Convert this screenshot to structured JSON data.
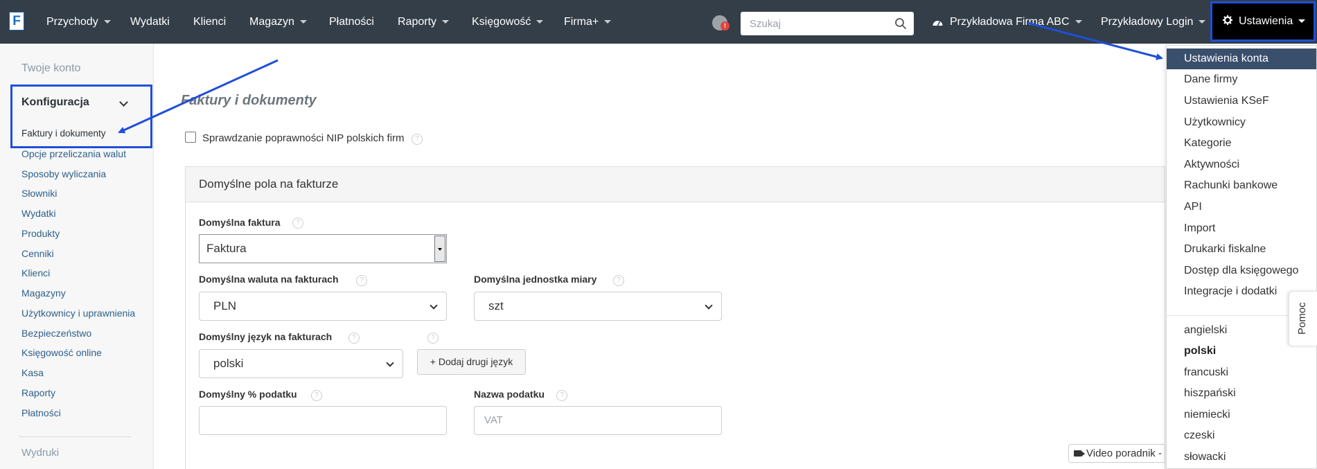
{
  "logo": {
    "letter": "F"
  },
  "nav": {
    "items": [
      {
        "label": "Przychody",
        "dropdown": true
      },
      {
        "label": "Wydatki",
        "dropdown": false
      },
      {
        "label": "Klienci",
        "dropdown": false
      },
      {
        "label": "Magazyn",
        "dropdown": true
      },
      {
        "label": "Płatności",
        "dropdown": false
      },
      {
        "label": "Raporty",
        "dropdown": true
      },
      {
        "label": "Księgowość",
        "dropdown": true
      },
      {
        "label": "Firma+",
        "dropdown": true
      }
    ],
    "search_placeholder": "Szukaj",
    "company": "Przykładowa Firma ABC",
    "login": "Przykładowy Login",
    "settings": "Ustawienia",
    "notification_badge": "!"
  },
  "sidebar": {
    "account": "Twoje konto",
    "section": "Konfiguracja",
    "items": [
      "Faktury i dokumenty",
      "Opcje przeliczania walut",
      "Sposoby wyliczania",
      "Słowniki",
      "Wydatki",
      "Produkty",
      "Cenniki",
      "Klienci",
      "Magazyny",
      "Użytkownicy i uprawnienia",
      "Bezpieczeństwo",
      "Księgowość online",
      "Kasa",
      "Raporty",
      "Płatności"
    ],
    "prints": "Wydruki"
  },
  "main": {
    "title": "Faktury i dokumenty",
    "nip_check_label": "Sprawdzanie poprawności NIP polskich firm",
    "nip_check_checked": false,
    "panel_title": "Domyślne pola na fakturze",
    "fields": {
      "invoice_label": "Domyślna faktura",
      "invoice_value": "Faktura",
      "currency_label": "Domyślna waluta na fakturach",
      "currency_value": "PLN",
      "unit_label": "Domyślna jednostka miary",
      "unit_value": "szt",
      "language_label": "Domyślny język na fakturach",
      "language_value": "polski",
      "add_language_button": "+ Dodaj drugi język",
      "tax_label": "Domyślny % podatku",
      "tax_value": "",
      "tax_name_label": "Nazwa podatku",
      "tax_name_placeholder": "VAT"
    },
    "video_button": "Video poradnik - I"
  },
  "settings_menu": {
    "items": [
      "Ustawienia konta",
      "Dane firmy",
      "Ustawienia KSeF",
      "Użytkownicy",
      "Kategorie",
      "Aktywności",
      "Rachunki bankowe",
      "API",
      "Import",
      "Drukarki fiskalne",
      "Dostęp dla księgowego",
      "Integracje i dodatki"
    ],
    "active_item": "Ustawienia konta",
    "languages": [
      "angielski",
      "polski",
      "francuski",
      "hiszpański",
      "niemiecki",
      "czeski",
      "słowacki"
    ],
    "selected_language": "polski"
  },
  "help_tab": "Pomoc",
  "colors": {
    "navbar": "#343e48",
    "accent_blue": "#1f4fd8",
    "menu_active": "#3a4f6c",
    "link": "#2d5f8b"
  }
}
